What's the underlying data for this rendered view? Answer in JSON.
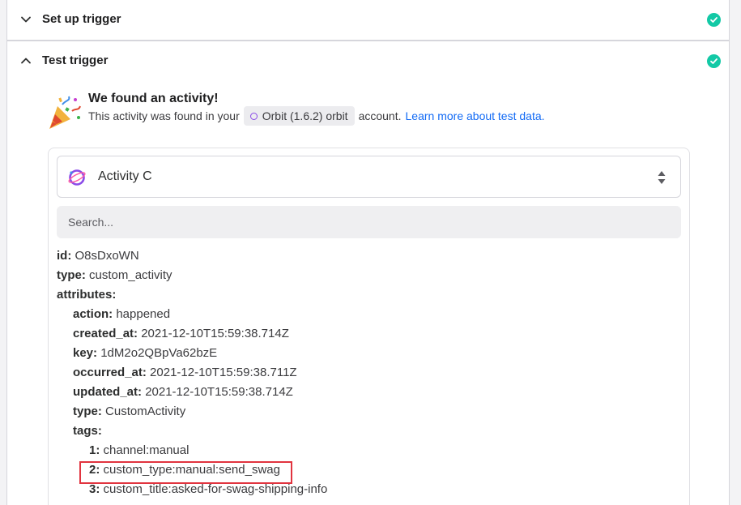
{
  "sections": {
    "setup": {
      "title": "Set up trigger",
      "status": "complete"
    },
    "test": {
      "title": "Test trigger",
      "status": "complete"
    }
  },
  "found": {
    "title": "We found an activity!",
    "prefix": "This activity was found in your",
    "account_badge": "Orbit (1.6.2) orbit",
    "suffix": "account.",
    "learn_link": "Learn more about test data."
  },
  "activity_select": {
    "value": "Activity C"
  },
  "search": {
    "placeholder": "Search..."
  },
  "record": {
    "id": {
      "key": "id:",
      "value": "O8sDxoWN"
    },
    "type": {
      "key": "type:",
      "value": "custom_activity"
    },
    "attributes_key": "attributes:",
    "attributes": {
      "action": {
        "key": "action:",
        "value": "happened"
      },
      "created_at": {
        "key": "created_at:",
        "value": "2021-12-10T15:59:38.714Z"
      },
      "key": {
        "key": "key:",
        "value": "1dM2o2QBpVa62bzE"
      },
      "occurred_at": {
        "key": "occurred_at:",
        "value": "2021-12-10T15:59:38.711Z"
      },
      "updated_at": {
        "key": "updated_at:",
        "value": "2021-12-10T15:59:38.714Z"
      },
      "type": {
        "key": "type:",
        "value": "CustomActivity"
      },
      "tags_key": "tags:",
      "tags": [
        {
          "key": "1:",
          "value": "channel:manual"
        },
        {
          "key": "2:",
          "value": "custom_type:manual:send_swag"
        },
        {
          "key": "3:",
          "value": "custom_title:asked-for-swag-shipping-info"
        }
      ]
    }
  },
  "colors": {
    "accent_link": "#136bf5",
    "success": "#13c9a6",
    "highlight": "#e1343f",
    "orbit": "#8b4be8"
  }
}
